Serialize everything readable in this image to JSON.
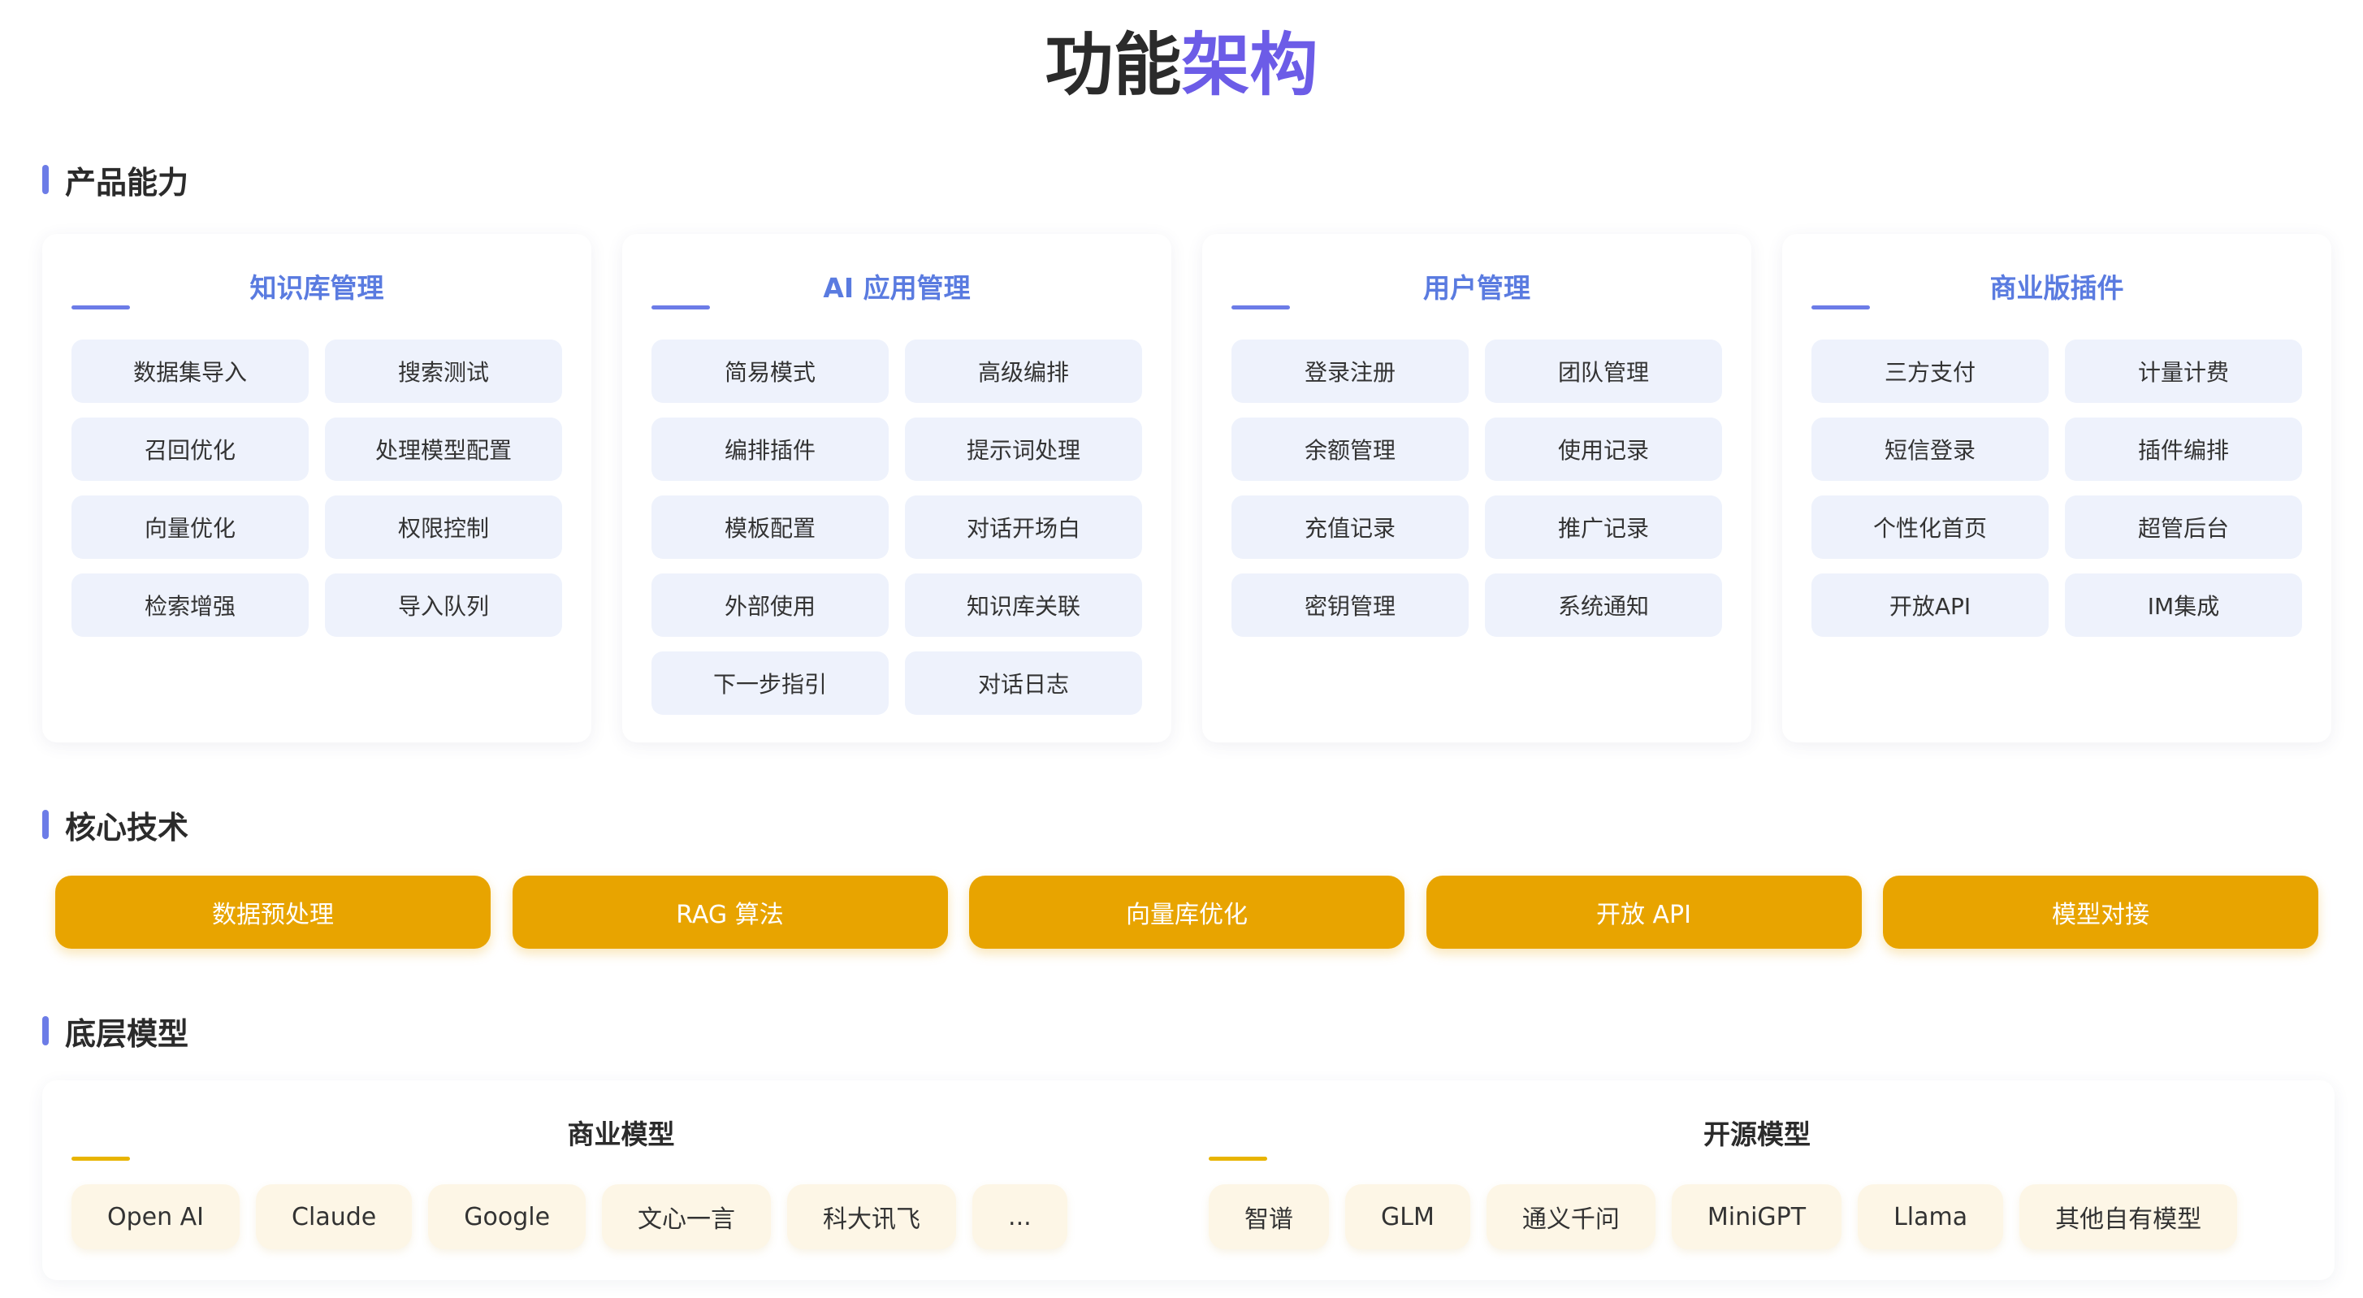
{
  "title": {
    "main": "功能",
    "accent": "架构"
  },
  "sections": {
    "product": "产品能力",
    "tech": "核心技术",
    "models": "底层模型"
  },
  "cards": [
    {
      "title": "知识库管理",
      "items": [
        "数据集导入",
        "搜索测试",
        "召回优化",
        "处理模型配置",
        "向量优化",
        "权限控制",
        "检索增强",
        "导入队列"
      ]
    },
    {
      "title": "AI 应用管理",
      "items": [
        "简易模式",
        "高级编排",
        "编排插件",
        "提示词处理",
        "模板配置",
        "对话开场白",
        "外部使用",
        "知识库关联",
        "下一步指引",
        "对话日志"
      ]
    },
    {
      "title": "用户管理",
      "items": [
        "登录注册",
        "团队管理",
        "余额管理",
        "使用记录",
        "充值记录",
        "推广记录",
        "密钥管理",
        "系统通知"
      ]
    },
    {
      "title": "商业版插件",
      "items": [
        "三方支付",
        "计量计费",
        "短信登录",
        "插件编排",
        "个性化首页",
        "超管后台",
        "开放API",
        "IM集成"
      ]
    }
  ],
  "tech": [
    "数据预处理",
    "RAG 算法",
    "向量库优化",
    "开放 API",
    "模型对接"
  ],
  "model_groups": [
    {
      "title": "商业模型",
      "items": [
        "Open AI",
        "Claude",
        "Google",
        "文心一言",
        "科大讯飞",
        "..."
      ]
    },
    {
      "title": "开源模型",
      "items": [
        "智谱",
        "GLM",
        "通义千问",
        "MiniGPT",
        "Llama",
        "其他自有模型"
      ]
    }
  ],
  "colors": {
    "accent_purple": "#6c5ce7",
    "card_title_blue": "#5a7be0",
    "tech_orange": "#e8a400",
    "chip_bg": "#eef2fc",
    "model_tag_bg": "#fdf6e6"
  }
}
